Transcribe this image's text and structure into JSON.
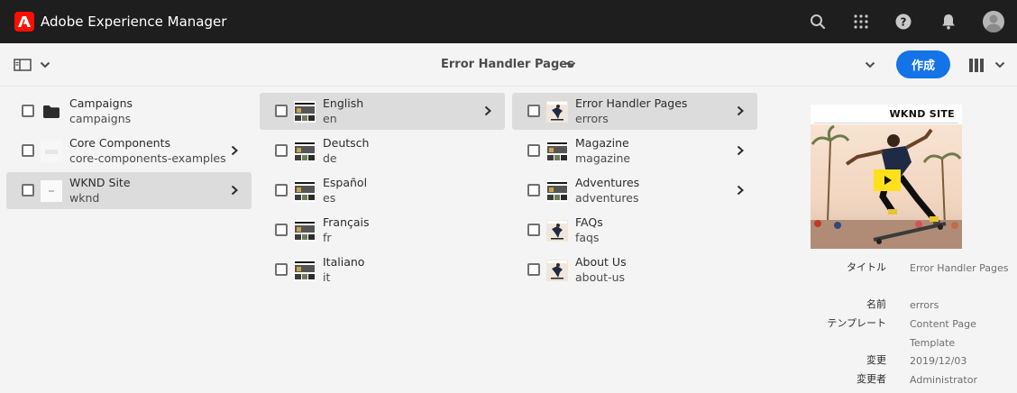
{
  "header": {
    "app_title": "Adobe Experience Manager",
    "icons": [
      "search-icon",
      "apps-grid-icon",
      "help-icon",
      "notifications-bell-icon",
      "user-avatar-icon"
    ]
  },
  "actionbar": {
    "view_title": "Error Handler Pages",
    "create_label": "作成",
    "accent_color": "#1473e6"
  },
  "columns": [
    {
      "items": [
        {
          "title": "Campaigns",
          "name": "campaigns",
          "has_children": false,
          "selected": false,
          "icon": "folder-icon"
        },
        {
          "title": "Core Components",
          "name": "core-components-examples",
          "has_children": true,
          "selected": false,
          "icon": "page-thumbnail"
        },
        {
          "title": "WKND Site",
          "name": "wknd",
          "has_children": true,
          "selected": true,
          "icon": "page-thumbnail"
        }
      ]
    },
    {
      "items": [
        {
          "title": "English",
          "name": "en",
          "has_children": true,
          "selected": true
        },
        {
          "title": "Deutsch",
          "name": "de",
          "has_children": false,
          "selected": false
        },
        {
          "title": "Español",
          "name": "es",
          "has_children": false,
          "selected": false
        },
        {
          "title": "Français",
          "name": "fr",
          "has_children": false,
          "selected": false
        },
        {
          "title": "Italiano",
          "name": "it",
          "has_children": false,
          "selected": false
        }
      ]
    },
    {
      "items": [
        {
          "title": "Error Handler Pages",
          "name": "errors",
          "has_children": true,
          "selected": true
        },
        {
          "title": "Magazine",
          "name": "magazine",
          "has_children": true,
          "selected": false
        },
        {
          "title": "Adventures",
          "name": "adventures",
          "has_children": true,
          "selected": false
        },
        {
          "title": "FAQs",
          "name": "faqs",
          "has_children": false,
          "selected": false
        },
        {
          "title": "About Us",
          "name": "about-us",
          "has_children": false,
          "selected": false
        }
      ]
    }
  ],
  "preview": {
    "image_heading": "WKND SITE",
    "meta": [
      {
        "label": "タイトル",
        "value": "Error Handler Pages"
      },
      {
        "label": "名前",
        "value": "errors"
      },
      {
        "label": "テンプレート",
        "value": "Content Page Template"
      },
      {
        "label": "変更",
        "value": "2019/12/03"
      },
      {
        "label": "変更者",
        "value": "Administrator"
      }
    ]
  }
}
